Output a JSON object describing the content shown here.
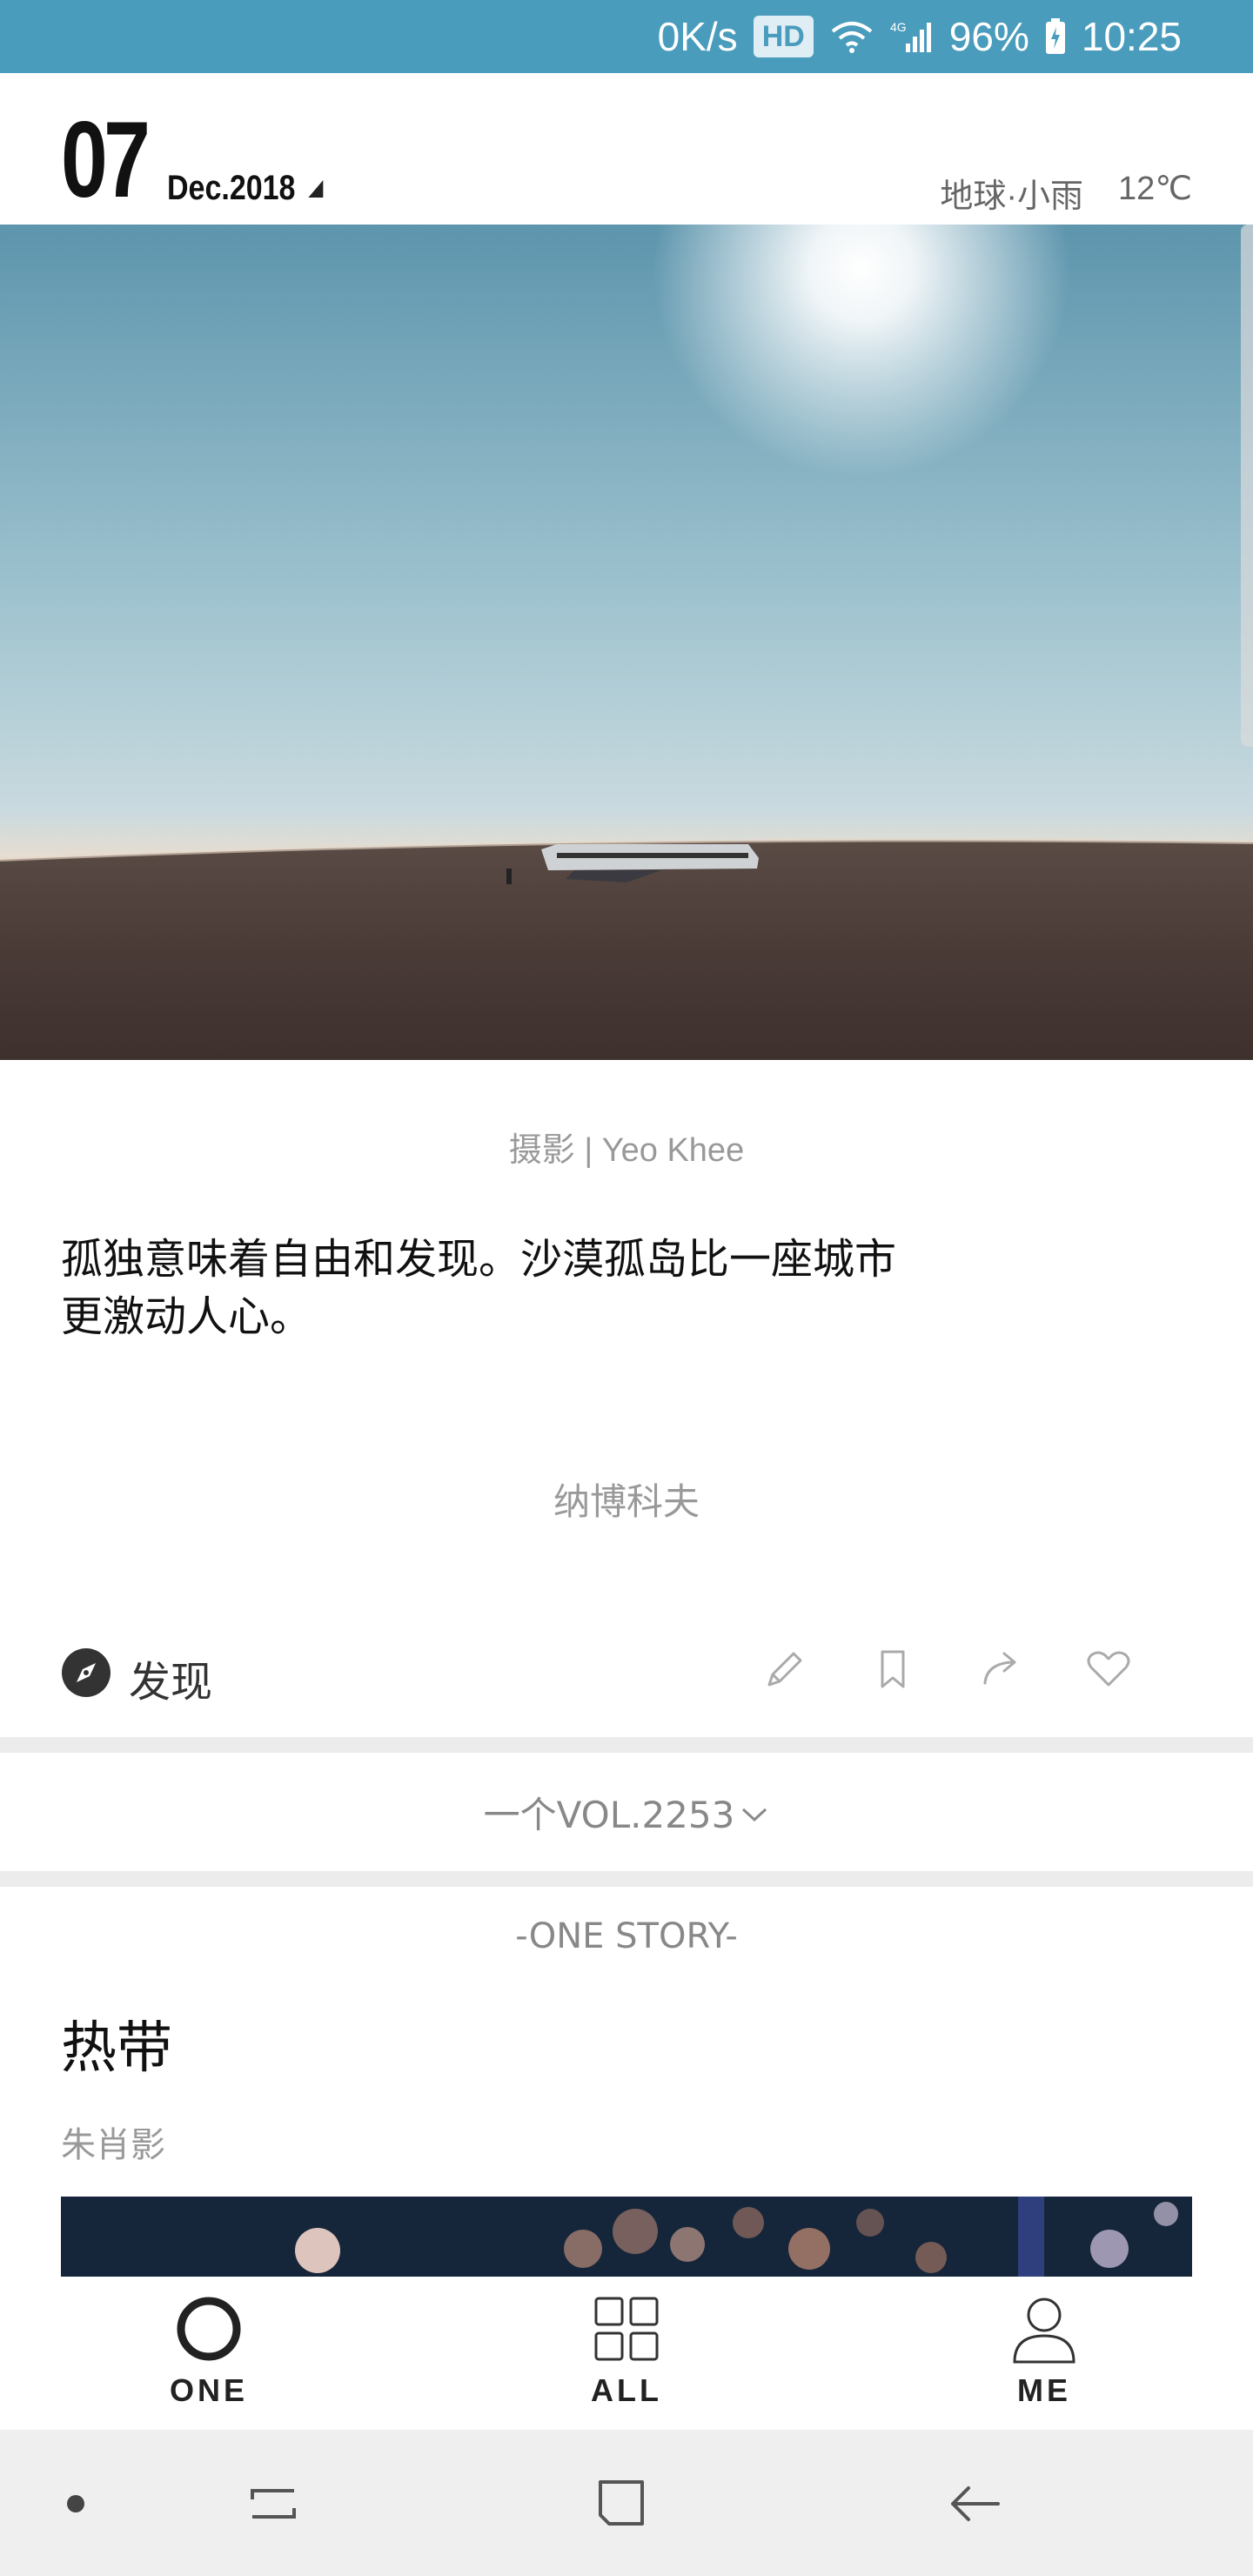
{
  "status_bar": {
    "net_speed": "0K/s",
    "hd_badge": "HD",
    "network_type": "4G",
    "battery": "96%",
    "time": "10:25"
  },
  "header": {
    "day": "07",
    "month_year": "Dec.2018",
    "location_weather": "地球·小雨",
    "temperature": "12℃"
  },
  "article": {
    "photo_credit": "摄影 | Yeo Khee",
    "quote": "孤独意味着自由和发现。沙漠孤岛比一座城市更激动人心。",
    "quote_author": "纳博科夫",
    "discover_label": "发现"
  },
  "volume": {
    "label": "一个VOL.2253"
  },
  "story": {
    "section_label": "-ONE STORY-",
    "title": "热带",
    "author": "朱肖影"
  },
  "tabs": [
    {
      "label": "ONE",
      "icon": "circle-icon"
    },
    {
      "label": "ALL",
      "icon": "grid-icon"
    },
    {
      "label": "ME",
      "icon": "person-icon"
    }
  ],
  "colors": {
    "status_bar": "#4a9cbd",
    "divider_band": "#ececec",
    "muted_text": "#999999"
  }
}
